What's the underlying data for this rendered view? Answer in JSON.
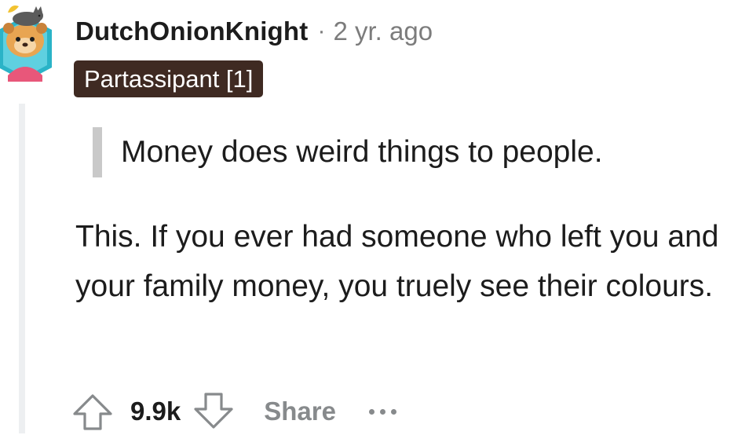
{
  "comment": {
    "username": "DutchOnionKnight",
    "separator": "·",
    "timestamp": "2 yr. ago",
    "flair": "Partassipant [1]",
    "quote": "Money does weird things to people.",
    "body": "This. If you ever had someone who left you and your family money, you truely see their colours.",
    "avatar_icon": "snoo-avatar-icon"
  },
  "actions": {
    "upvote_icon": "upvote-arrow-icon",
    "score": "9.9k",
    "downvote_icon": "downvote-arrow-icon",
    "share_label": "Share",
    "more_icon": "more-options-icon"
  },
  "colors": {
    "flair_background": "#3f2a22",
    "flair_text": "#ffffff",
    "muted_text": "#7c7c7c",
    "action_gray": "#878a8c",
    "quote_bar": "#c9c9c9",
    "thread_line": "#edeff1"
  }
}
